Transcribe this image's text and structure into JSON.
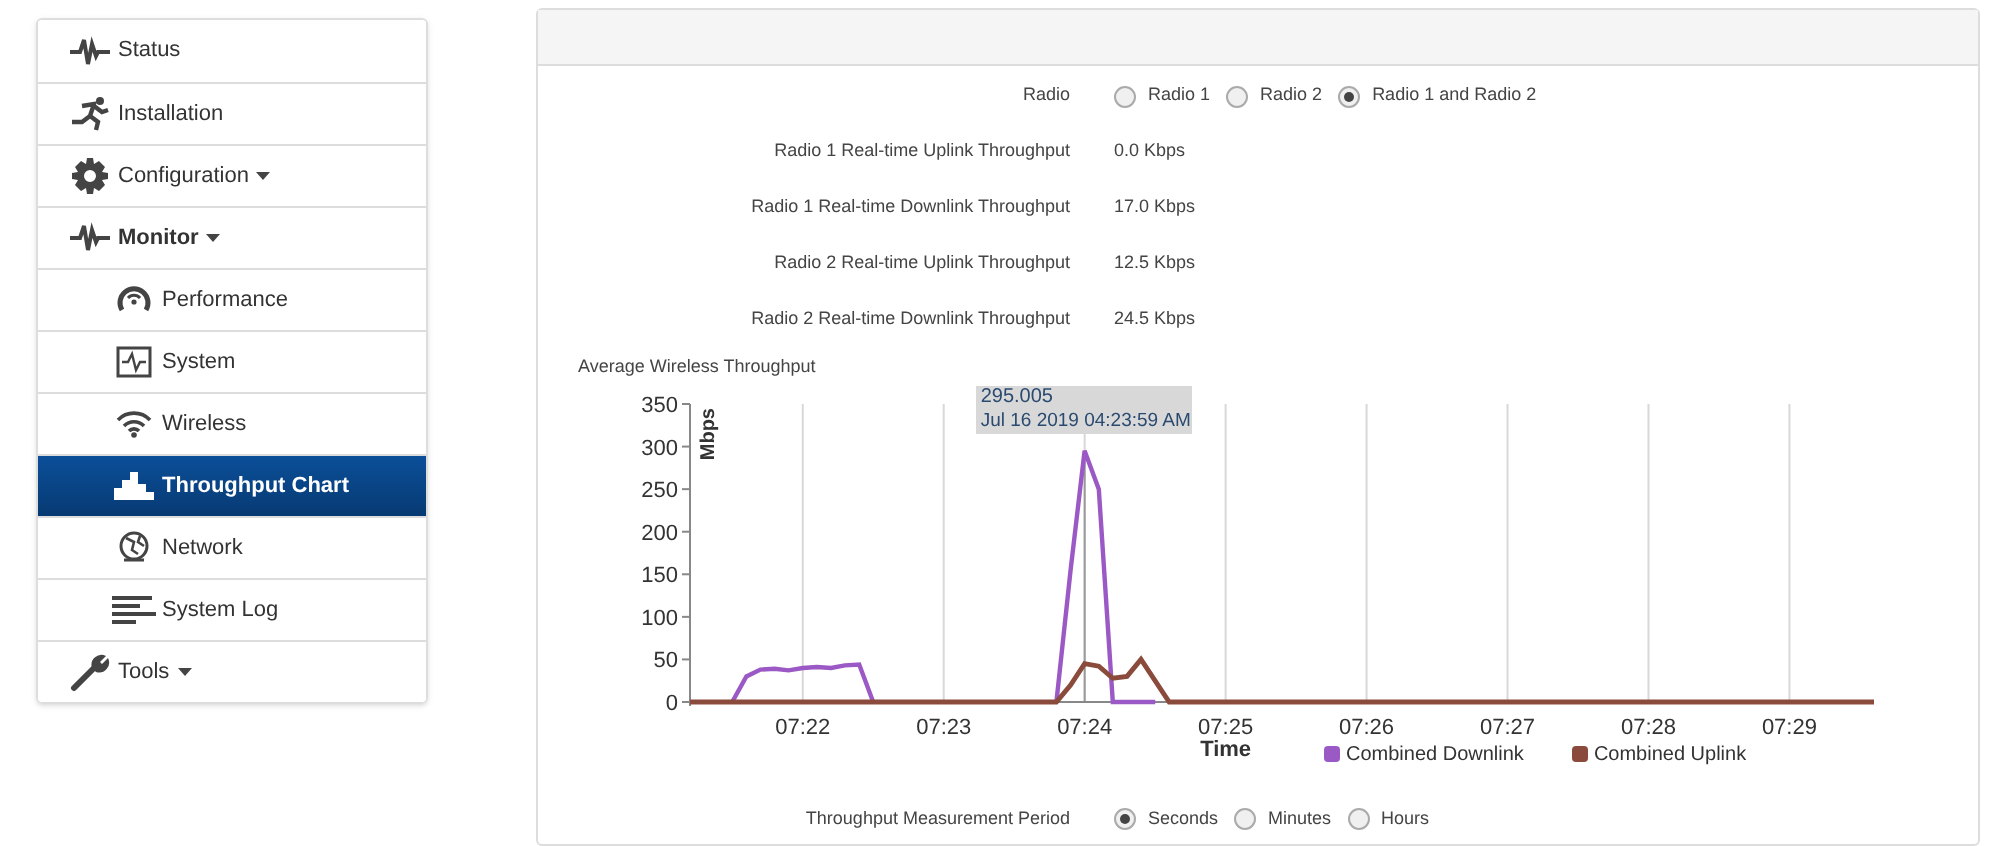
{
  "sidebar": {
    "items": [
      {
        "label": "Status",
        "kind": "link",
        "selected": false
      },
      {
        "label": "Installation",
        "kind": "link",
        "selected": false
      },
      {
        "label": "Configuration",
        "kind": "dropdown",
        "selected": false,
        "expanded": false
      },
      {
        "label": "Monitor",
        "kind": "dropdown",
        "selected": false,
        "expanded": true,
        "children": [
          {
            "label": "Performance",
            "selected": false
          },
          {
            "label": "System",
            "selected": false
          },
          {
            "label": "Wireless",
            "selected": false
          },
          {
            "label": "Throughput Chart",
            "selected": true
          },
          {
            "label": "Network",
            "selected": false
          },
          {
            "label": "System Log",
            "selected": false
          }
        ]
      },
      {
        "label": "Tools",
        "kind": "dropdown",
        "selected": false,
        "expanded": false
      }
    ]
  },
  "radio": {
    "label": "Radio",
    "options": [
      {
        "label": "Radio 1",
        "selected": false
      },
      {
        "label": "Radio 2",
        "selected": false
      },
      {
        "label": "Radio 1 and Radio 2",
        "selected": true
      }
    ]
  },
  "stats": [
    {
      "label": "Radio 1 Real-time Uplink Throughput",
      "value": "0.0 Kbps"
    },
    {
      "label": "Radio 1 Real-time Downlink Throughput",
      "value": "17.0 Kbps"
    },
    {
      "label": "Radio 2 Real-time Uplink Throughput",
      "value": "12.5 Kbps"
    },
    {
      "label": "Radio 2 Real-time Downlink Throughput",
      "value": "24.5 Kbps"
    }
  ],
  "chart": {
    "title": "Average Wireless Throughput",
    "chart_data": {
      "type": "line",
      "xlabel": "Time",
      "ylabel": "Mbps",
      "categories": [
        null,
        null,
        null,
        null,
        null,
        null,
        null,
        null,
        "07:22",
        null,
        null,
        null,
        null,
        null,
        null,
        null,
        null,
        null,
        "07:23",
        null,
        null,
        null,
        null,
        null,
        null,
        null,
        null,
        null,
        "07:24",
        null,
        null,
        null,
        null,
        null,
        null,
        null,
        null,
        null,
        "07:25",
        null,
        null,
        null,
        null,
        null,
        null,
        null,
        null,
        null,
        "07:26",
        null,
        null,
        null,
        null,
        null,
        null,
        null,
        null,
        null,
        "07:27",
        null,
        null,
        null,
        null,
        null,
        null,
        null,
        null,
        null,
        "07:28",
        null,
        null,
        null,
        null,
        null,
        null,
        null,
        null,
        null,
        "07:29",
        null,
        null,
        null,
        null,
        null,
        null
      ],
      "series": [
        {
          "name": "Combined Downlink",
          "color": "#9b59c6",
          "values": [
            null,
            null,
            null,
            0,
            30,
            38,
            39,
            37,
            40,
            41,
            40,
            43,
            44,
            0,
            null,
            null,
            null,
            null,
            null,
            null,
            null,
            null,
            null,
            null,
            null,
            null,
            0,
            155,
            295,
            250,
            0,
            0,
            0,
            0,
            null,
            null,
            null,
            null,
            null,
            null,
            null,
            null,
            null,
            null,
            null,
            null,
            null,
            null,
            null,
            null,
            null,
            null,
            null,
            null,
            null,
            null,
            null,
            null,
            null,
            null,
            null,
            null,
            null,
            null,
            null,
            null,
            null,
            null,
            null,
            null,
            null,
            null,
            null,
            null,
            null,
            null,
            null,
            null,
            null,
            null,
            null,
            null,
            null,
            null,
            null
          ]
        },
        {
          "name": "Combined Uplink",
          "color": "#8a4a3c",
          "values": [
            0,
            0,
            0,
            0,
            0,
            0,
            0,
            0,
            0,
            0,
            0,
            0,
            0,
            0,
            0,
            0,
            0,
            0,
            0,
            0,
            0,
            0,
            0,
            0,
            0,
            0,
            0,
            20,
            45,
            42,
            28,
            30,
            50,
            25,
            0,
            0,
            0,
            0,
            0,
            0,
            0,
            0,
            0,
            0,
            0,
            0,
            0,
            0,
            0,
            0,
            0,
            0,
            0,
            0,
            0,
            0,
            0,
            0,
            0,
            0,
            0,
            0,
            0,
            0,
            0,
            0,
            0,
            0,
            0,
            0,
            0,
            0,
            0,
            0,
            0,
            0,
            0,
            0,
            0,
            0,
            0,
            0,
            0,
            0,
            0
          ]
        }
      ],
      "ylim": [
        0,
        350
      ],
      "grid": true,
      "yticks": [
        0,
        50,
        100,
        150,
        200,
        250,
        300,
        350
      ],
      "annotations": [
        {
          "x": "07:24",
          "y": 295.005,
          "text": "295.005"
        },
        {
          "x": "07:24",
          "y": 295.005,
          "text": "Jul 16 2019 04:23:59 AM"
        }
      ]
    }
  },
  "period": {
    "label": "Throughput Measurement Period",
    "options": [
      {
        "label": "Seconds",
        "selected": true
      },
      {
        "label": "Minutes",
        "selected": false
      },
      {
        "label": "Hours",
        "selected": false
      }
    ]
  }
}
